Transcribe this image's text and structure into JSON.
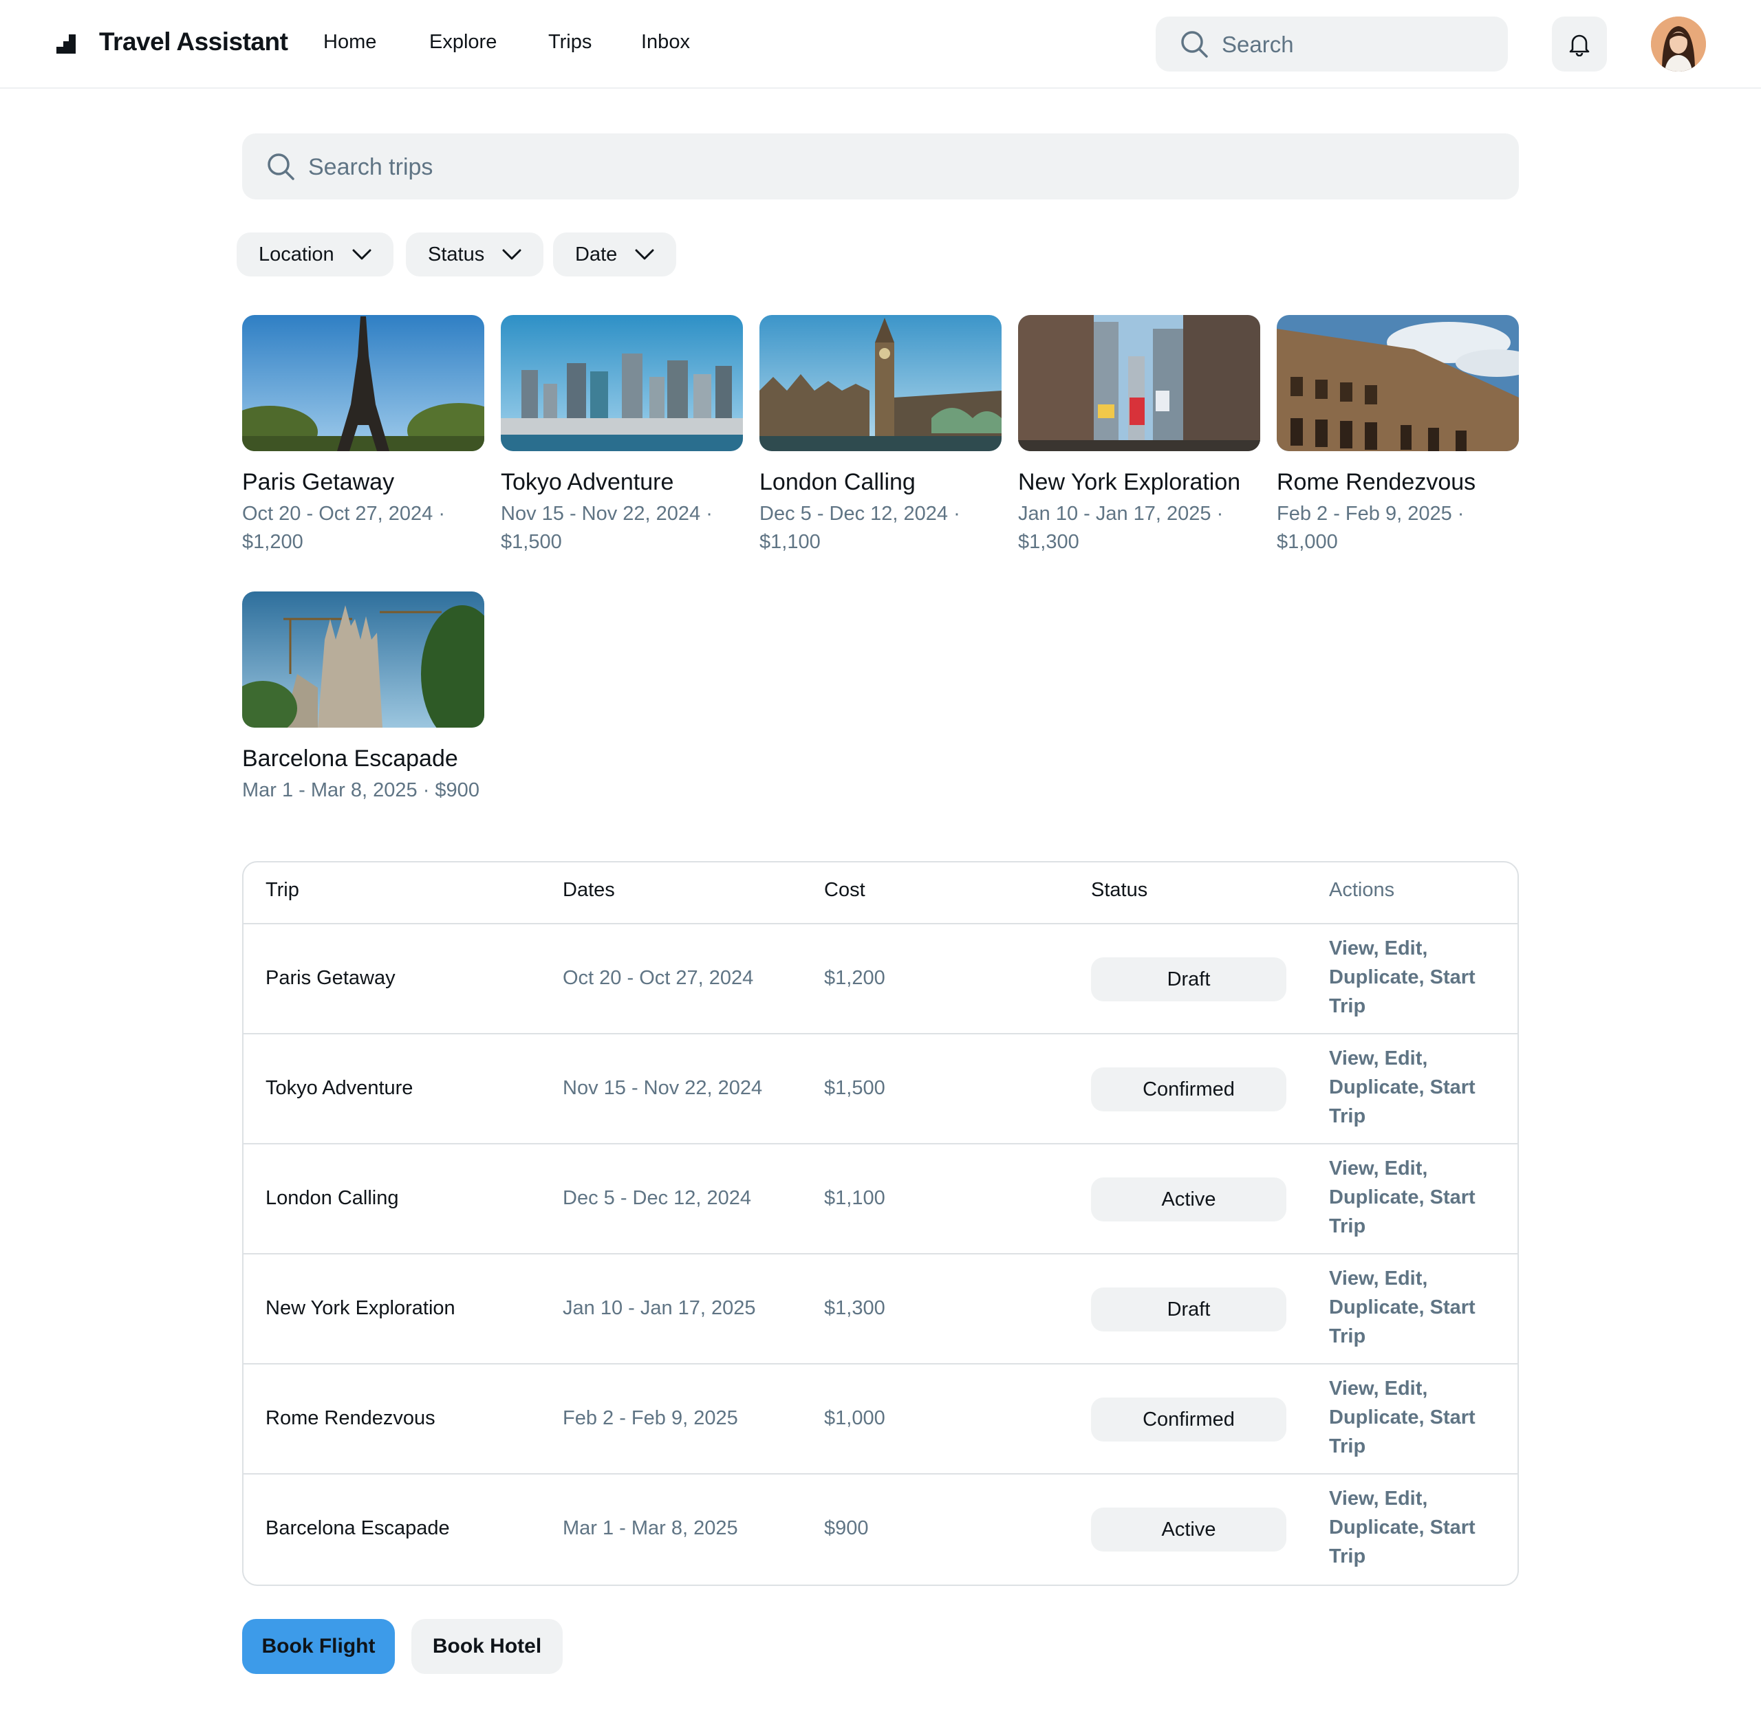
{
  "app": {
    "title": "Travel Assistant"
  },
  "nav": {
    "links": [
      "Home",
      "Explore",
      "Trips",
      "Inbox"
    ]
  },
  "header": {
    "search_placeholder": "Search"
  },
  "trip_search": {
    "placeholder": "Search trips"
  },
  "filters": [
    "Location",
    "Status",
    "Date"
  ],
  "cards": [
    {
      "name": "Paris Getaway",
      "meta": "Oct 20 - Oct 27, 2024 · $1,200"
    },
    {
      "name": "Tokyo Adventure",
      "meta": "Nov 15 - Nov 22, 2024 · $1,500"
    },
    {
      "name": "London Calling",
      "meta": "Dec 5 - Dec 12, 2024 · $1,100"
    },
    {
      "name": "New York Exploration",
      "meta": "Jan 10 - Jan 17, 2025 · $1,300"
    },
    {
      "name": "Rome Rendezvous",
      "meta": "Feb 2 - Feb 9, 2025 · $1,000"
    },
    {
      "name": "Barcelona Escapade",
      "meta": "Mar 1 - Mar 8, 2025 · $900"
    }
  ],
  "table": {
    "headers": [
      "Trip",
      "Dates",
      "Cost",
      "Status",
      "Actions"
    ],
    "rows": [
      {
        "trip": "Paris Getaway",
        "dates": "Oct 20 - Oct 27, 2024",
        "cost": "$1,200",
        "status": "Draft",
        "actions": "View, Edit, Duplicate, Start Trip"
      },
      {
        "trip": "Tokyo Adventure",
        "dates": "Nov 15 - Nov 22, 2024",
        "cost": "$1,500",
        "status": "Confirmed",
        "actions": "View, Edit, Duplicate, Start Trip"
      },
      {
        "trip": "London Calling",
        "dates": "Dec 5 - Dec 12, 2024",
        "cost": "$1,100",
        "status": "Active",
        "actions": "View, Edit, Duplicate, Start Trip"
      },
      {
        "trip": "New York Exploration",
        "dates": "Jan 10 - Jan 17, 2025",
        "cost": "$1,300",
        "status": "Draft",
        "actions": "View, Edit, Duplicate, Start Trip"
      },
      {
        "trip": "Rome Rendezvous",
        "dates": "Feb 2 - Feb 9, 2025",
        "cost": "$1,000",
        "status": "Confirmed",
        "actions": "View, Edit, Duplicate, Start Trip"
      },
      {
        "trip": "Barcelona Escapade",
        "dates": "Mar 1 - Mar 8, 2025",
        "cost": "$900",
        "status": "Active",
        "actions": "View, Edit, Duplicate, Start Trip"
      }
    ]
  },
  "buttons": {
    "book_flight": "Book Flight",
    "book_hotel": "Book Hotel"
  },
  "colors": {
    "primary": "#3d9be9",
    "muted_text": "#5f7484",
    "chip_bg": "#f0f2f3",
    "border": "#dde1e4"
  },
  "icons": [
    "logo-icon",
    "search-icon",
    "bell-icon",
    "chevron-down-icon",
    "avatar"
  ]
}
